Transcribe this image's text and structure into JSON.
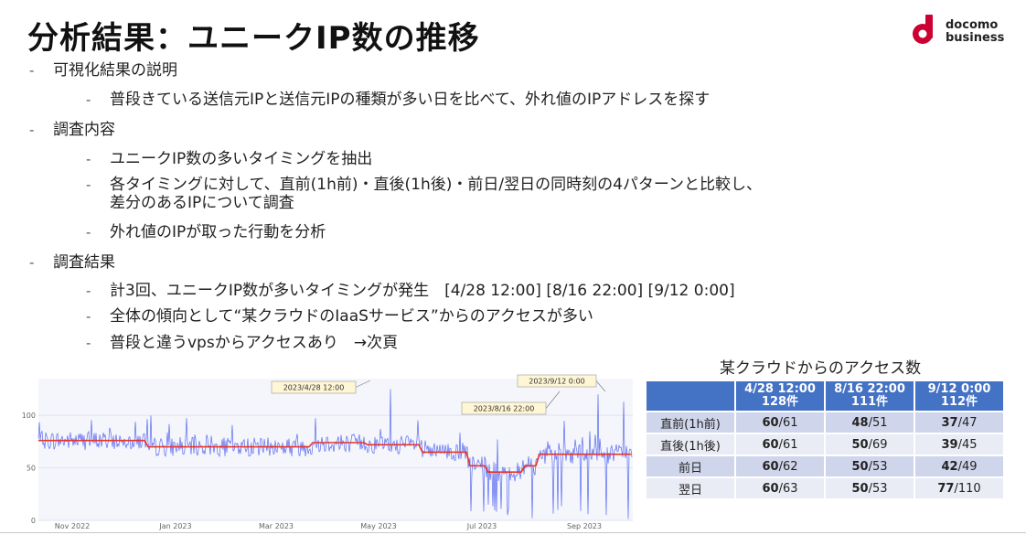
{
  "title": "分析結果：ユニークIP数の推移",
  "logo": {
    "line1": "docomo",
    "line2": "business",
    "color": "#cc0033"
  },
  "bullets": [
    {
      "level": 1,
      "text": "可視化結果の説明"
    },
    {
      "level": 2,
      "text": "普段きている送信元IPと送信元IPの種類が多い日を比べて、外れ値のIPアドレスを探す"
    },
    {
      "level": 1,
      "text": "調査内容"
    },
    {
      "level": 2,
      "text": "ユニークIP数の多いタイミングを抽出"
    },
    {
      "level": 2,
      "text": "各タイミングに対して、直前(1h前)・直後(1h後)・前日/翌日の同時刻の4パターンと比較し、"
    },
    {
      "level": 3,
      "text": "差分のあるIPについて調査"
    },
    {
      "level": 2,
      "text": "外れ値のIPが取った行動を分析"
    },
    {
      "level": 1,
      "text": "調査結果"
    },
    {
      "level": 2,
      "text": "計3回、ユニークIP数が多いタイミングが発生　[4/28 12:00] [8/16 22:00] [9/12 0:00]"
    },
    {
      "level": 2,
      "text": "全体の傾向として“某クラウドのIaaSサービス”からのアクセスが多い"
    },
    {
      "level": 2,
      "text": "普段と違うvpsからアクセスあり　→次頁"
    }
  ],
  "chart_data": {
    "type": "line",
    "x_ticks": [
      "Nov 2022",
      "Jan 2023",
      "Mar 2023",
      "May 2023",
      "Jul 2023",
      "Sep 2023"
    ],
    "y_ticks": [
      "0",
      "50",
      "100"
    ],
    "ylim": [
      0,
      135
    ],
    "series": [
      {
        "color": "#5b6bf0"
      },
      {
        "color": "#e8332a"
      }
    ],
    "annotations": [
      {
        "label": "2023/4/28 12:00"
      },
      {
        "label": "2023/8/16 22:00"
      },
      {
        "label": "2023/9/12 0:00"
      }
    ]
  },
  "table": {
    "caption": "某クラウドからのアクセス数",
    "headers": [
      {
        "line1": "",
        "line2": ""
      },
      {
        "line1": "4/28 12:00",
        "line2": "128件"
      },
      {
        "line1": "8/16 22:00",
        "line2": "111件"
      },
      {
        "line1": "9/12 0:00",
        "line2": "112件"
      }
    ],
    "rows": [
      {
        "label": "直前(1h前)",
        "cells": [
          {
            "bold": "60",
            "rest": "/61"
          },
          {
            "bold": "48",
            "rest": "/51"
          },
          {
            "bold": "37",
            "rest": "/47"
          }
        ]
      },
      {
        "label": "直後(1h後)",
        "cells": [
          {
            "bold": "60",
            "rest": "/61"
          },
          {
            "bold": "50",
            "rest": "/69"
          },
          {
            "bold": "39",
            "rest": "/45"
          }
        ]
      },
      {
        "label": "前日",
        "cells": [
          {
            "bold": "60",
            "rest": "/62"
          },
          {
            "bold": "50",
            "rest": "/53"
          },
          {
            "bold": "42",
            "rest": "/49"
          }
        ]
      },
      {
        "label": "翌日",
        "cells": [
          {
            "bold": "60",
            "rest": "/63"
          },
          {
            "bold": "50",
            "rest": "/53"
          },
          {
            "bold": "77",
            "rest": "/110"
          }
        ]
      }
    ]
  }
}
